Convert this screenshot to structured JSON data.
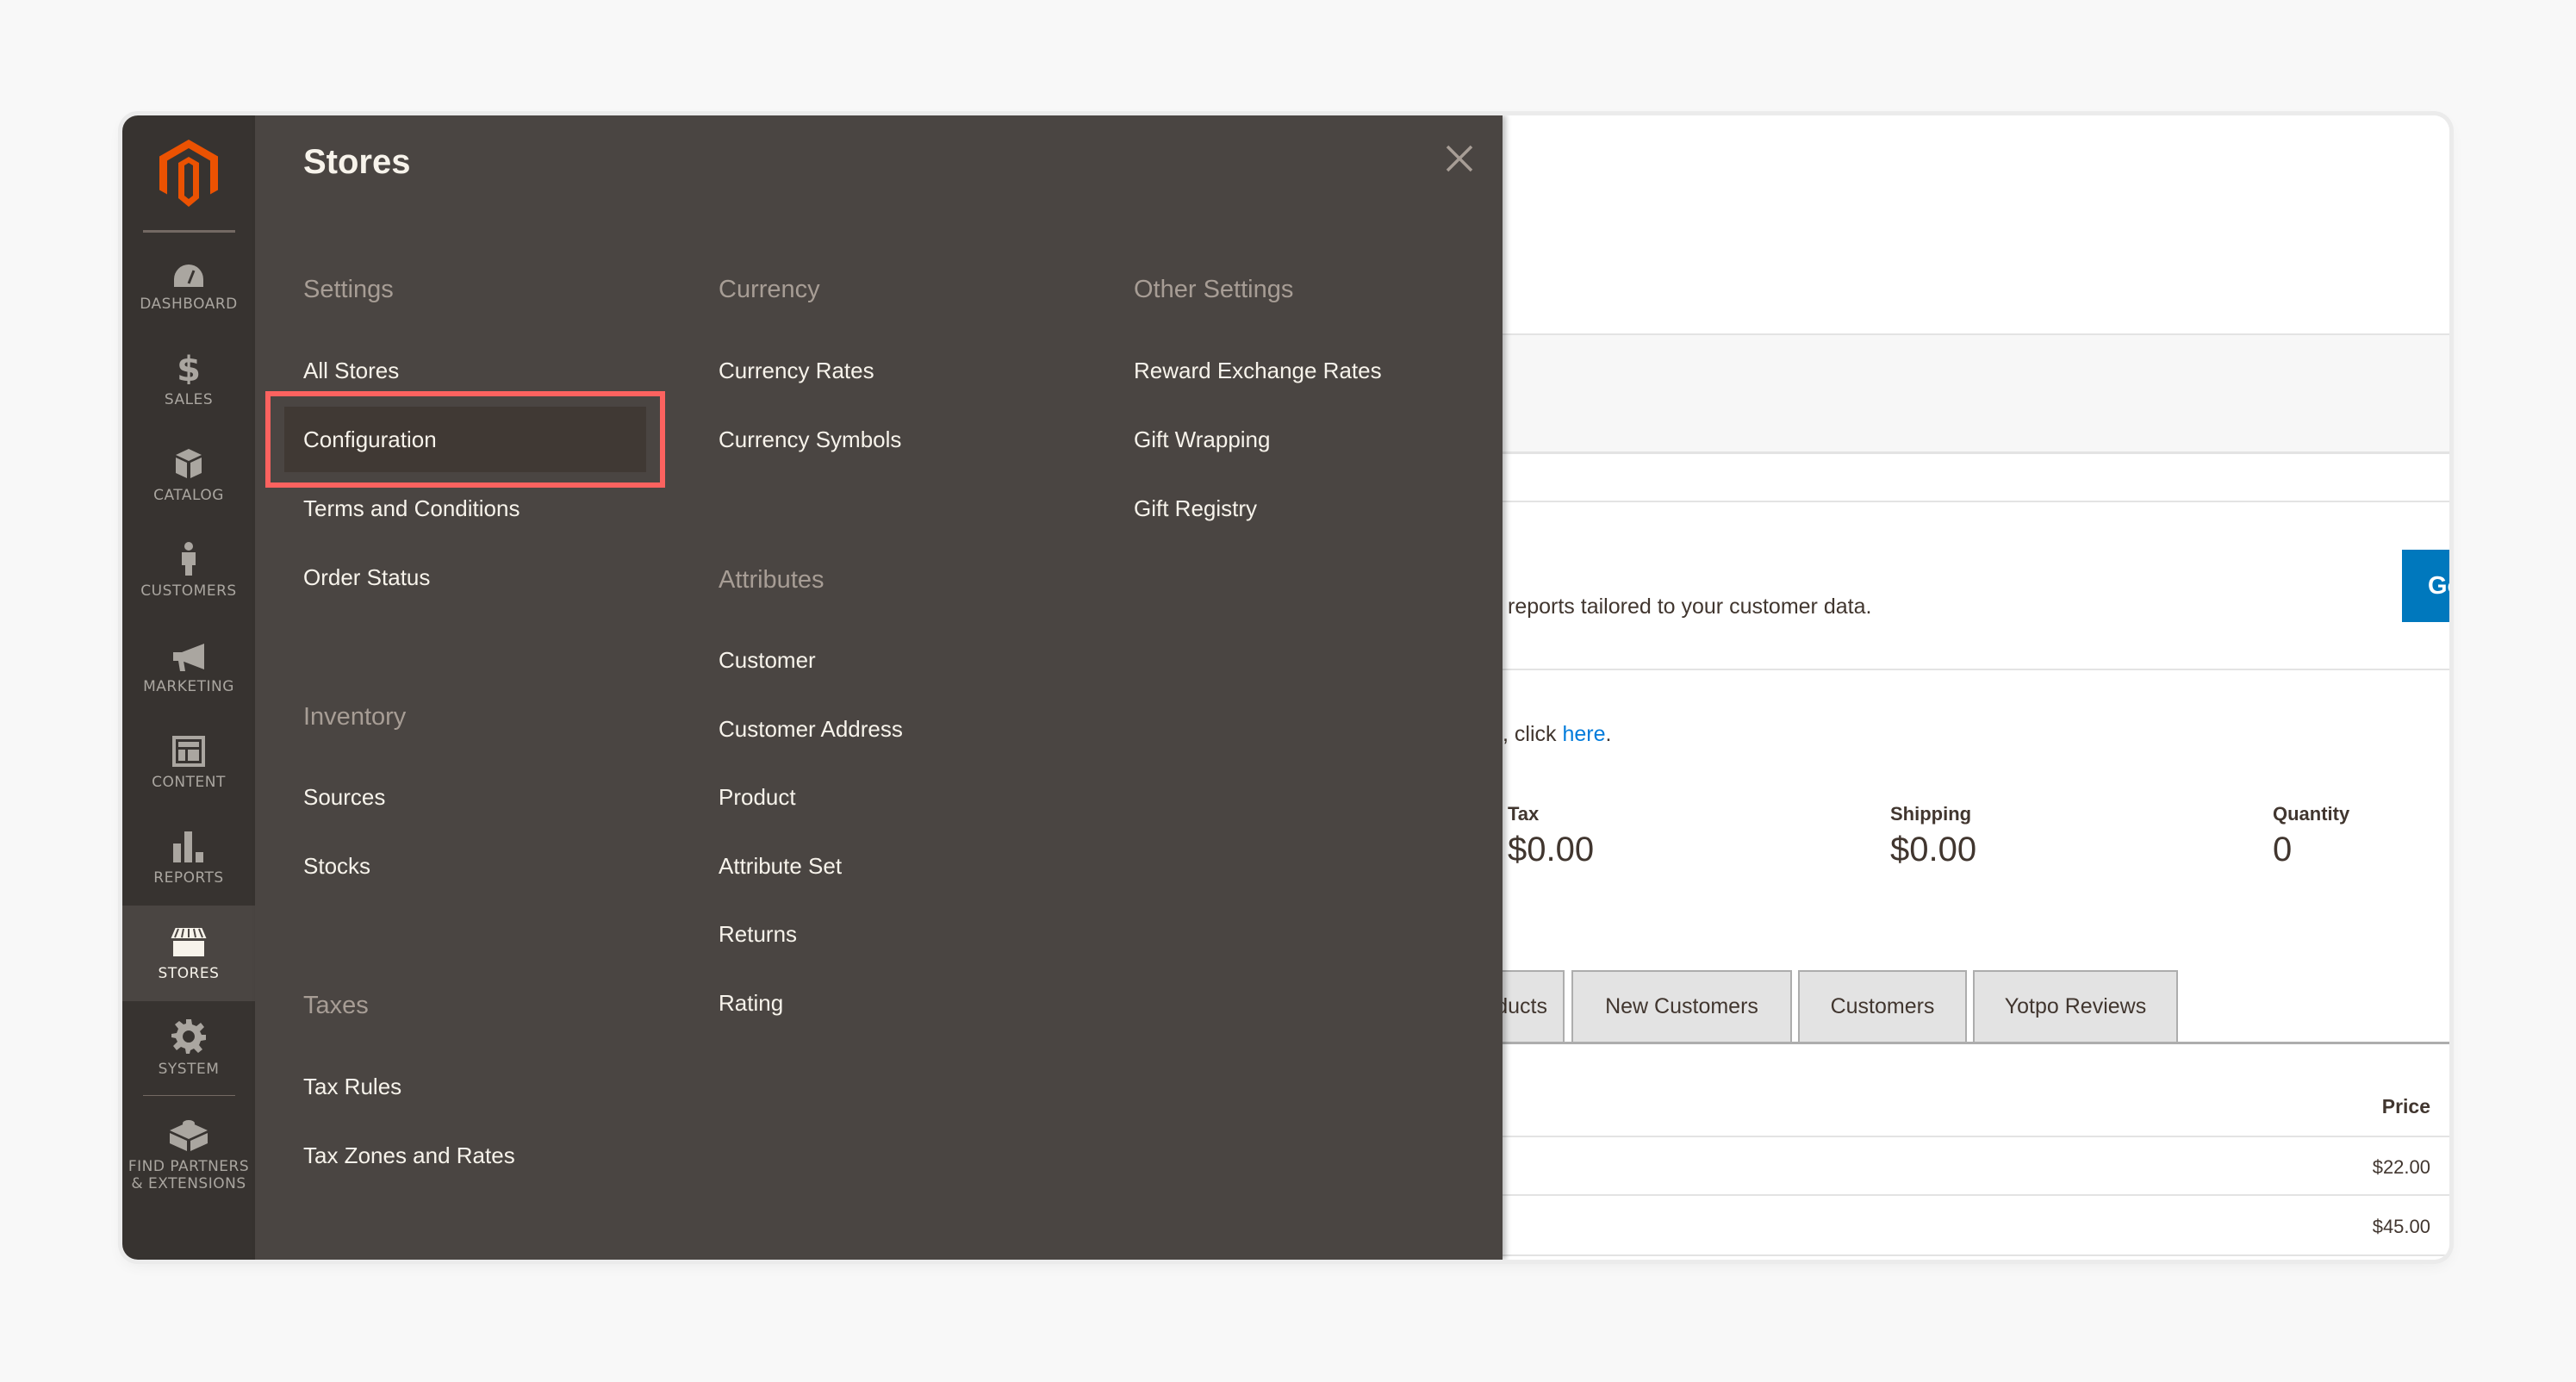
{
  "app": {
    "name": "Magento Admin",
    "accent_color": "#eb5202",
    "highlight_color": "#fc625f"
  },
  "sidebar": {
    "logo": "magento-logo",
    "items": [
      {
        "label": "Dashboard",
        "icon": "dashboard-icon",
        "active": false
      },
      {
        "label": "Sales",
        "icon": "dollar-icon",
        "active": false
      },
      {
        "label": "Catalog",
        "icon": "box-icon",
        "active": false
      },
      {
        "label": "Customers",
        "icon": "person-icon",
        "active": false
      },
      {
        "label": "Marketing",
        "icon": "megaphone-icon",
        "active": false
      },
      {
        "label": "Content",
        "icon": "layout-icon",
        "active": false
      },
      {
        "label": "Reports",
        "icon": "bar-chart-icon",
        "active": false
      },
      {
        "label": "Stores",
        "icon": "storefront-icon",
        "active": true
      },
      {
        "label": "System",
        "icon": "gear-icon",
        "active": false
      },
      {
        "label": "Find Partners & Extensions",
        "label_line1": "Find Partners",
        "label_line2": "& Extensions",
        "icon": "lego-block-icon",
        "active": false
      }
    ]
  },
  "menu": {
    "title": "Stores",
    "close_icon": "close-icon",
    "highlighted_item": "Configuration",
    "columns": [
      {
        "sections": [
          {
            "title": "Settings",
            "items": [
              "All Stores",
              "Configuration",
              "Terms and Conditions",
              "Order Status"
            ]
          },
          {
            "title": "Inventory",
            "items": [
              "Sources",
              "Stocks"
            ]
          },
          {
            "title": "Taxes",
            "items": [
              "Tax Rules",
              "Tax Zones and Rates"
            ]
          }
        ]
      },
      {
        "sections": [
          {
            "title": "Currency",
            "items": [
              "Currency Rates",
              "Currency Symbols"
            ]
          },
          {
            "title": "Attributes",
            "items": [
              "Customer",
              "Customer Address",
              "Product",
              "Attribute Set",
              "Returns",
              "Rating"
            ]
          }
        ]
      },
      {
        "sections": [
          {
            "title": "Other Settings",
            "items": [
              "Reward Exchange Rates",
              "Gift Wrapping",
              "Gift Registry"
            ]
          }
        ]
      }
    ]
  },
  "page": {
    "advanced_reporting_text": "reports tailored to your customer data.",
    "advanced_reporting_button": "Go to Advanced Reporting",
    "click_text_prefix": ", click ",
    "click_link": "here",
    "click_text_suffix": ".",
    "stats": [
      {
        "label": "Tax",
        "value": "$0.00"
      },
      {
        "label": "Shipping",
        "value": "$0.00"
      },
      {
        "label": "Quantity",
        "value": "0"
      }
    ],
    "tabs": [
      "Products",
      "New Customers",
      "Customers",
      "Yotpo Reviews"
    ],
    "table": {
      "columns": [
        "Price"
      ],
      "rows": [
        {
          "price": "$22.00"
        },
        {
          "price": "$45.00"
        }
      ]
    }
  }
}
